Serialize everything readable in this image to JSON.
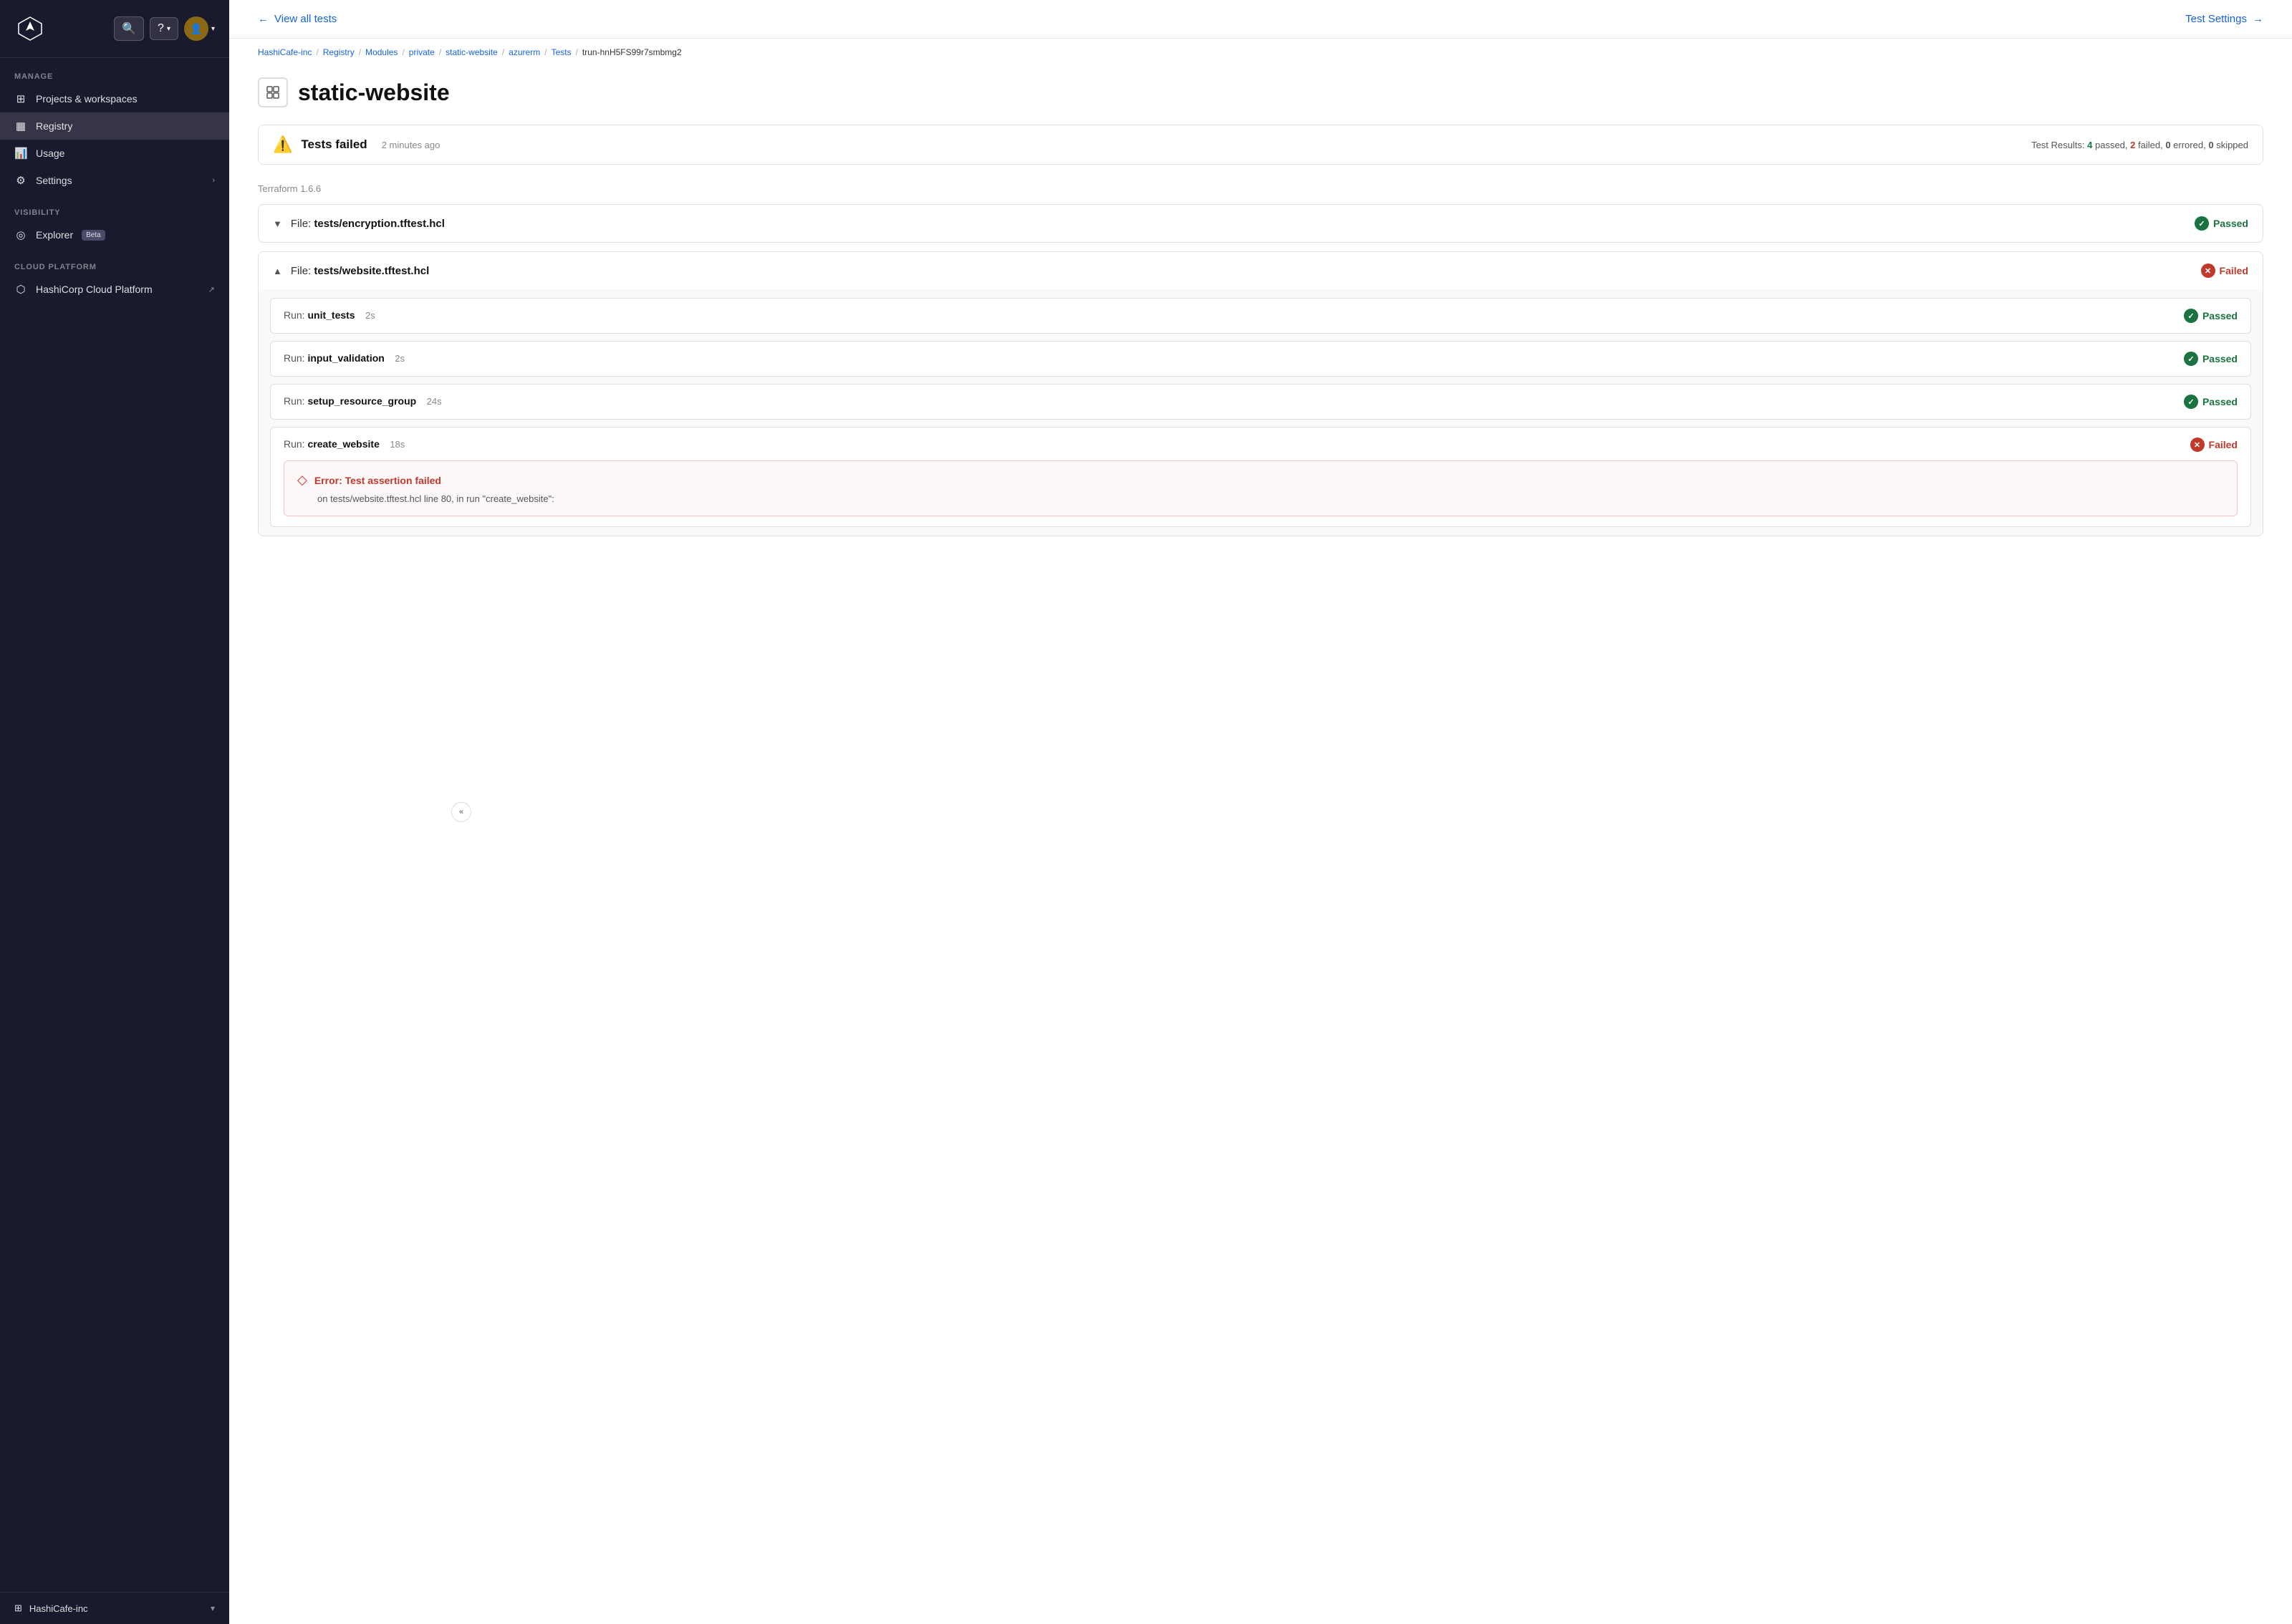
{
  "sidebar": {
    "manage_label": "Manage",
    "projects_label": "Projects & workspaces",
    "registry_label": "Registry",
    "usage_label": "Usage",
    "settings_label": "Settings",
    "visibility_label": "Visibility",
    "explorer_label": "Explorer",
    "beta_label": "Beta",
    "cloud_platform_label": "Cloud Platform",
    "hashicorp_cloud_label": "HashiCorp Cloud Platform",
    "org_label": "HashiCafe-inc"
  },
  "topbar": {
    "view_all_tests": "View all tests",
    "test_settings": "Test Settings"
  },
  "breadcrumb": {
    "items": [
      "HashiCafe-inc",
      "Registry",
      "Modules",
      "private",
      "static-website",
      "azurerm",
      "Tests"
    ],
    "current": "trun-hnH5FS99r7smbmg2"
  },
  "page": {
    "title": "static-website",
    "terraform_version": "Terraform 1.6.6"
  },
  "status": {
    "title": "Tests failed",
    "time": "2 minutes ago",
    "results_label": "Test Results:",
    "passed_count": "4",
    "passed_label": "passed",
    "failed_count": "2",
    "failed_label": "failed",
    "errored_count": "0",
    "errored_label": "errored",
    "skipped_count": "0",
    "skipped_label": "skipped"
  },
  "test_files": [
    {
      "id": "encryption",
      "file_prefix": "File:",
      "file_name": "tests/encryption.tftest.hcl",
      "status": "Passed",
      "expanded": false,
      "runs": []
    },
    {
      "id": "website",
      "file_prefix": "File:",
      "file_name": "tests/website.tftest.hcl",
      "status": "Failed",
      "expanded": true,
      "runs": [
        {
          "id": "unit_tests",
          "run_prefix": "Run:",
          "run_name": "unit_tests",
          "duration": "2s",
          "status": "Passed",
          "has_error": false
        },
        {
          "id": "input_validation",
          "run_prefix": "Run:",
          "run_name": "input_validation",
          "duration": "2s",
          "status": "Passed",
          "has_error": false
        },
        {
          "id": "setup_resource_group",
          "run_prefix": "Run:",
          "run_name": "setup_resource_group",
          "duration": "24s",
          "status": "Passed",
          "has_error": false
        },
        {
          "id": "create_website",
          "run_prefix": "Run:",
          "run_name": "create_website",
          "duration": "18s",
          "status": "Failed",
          "has_error": true,
          "error_title": "Error: Test assertion failed",
          "error_body": "on tests/website.tftest.hcl line 80, in run \"create_website\":"
        }
      ]
    }
  ]
}
